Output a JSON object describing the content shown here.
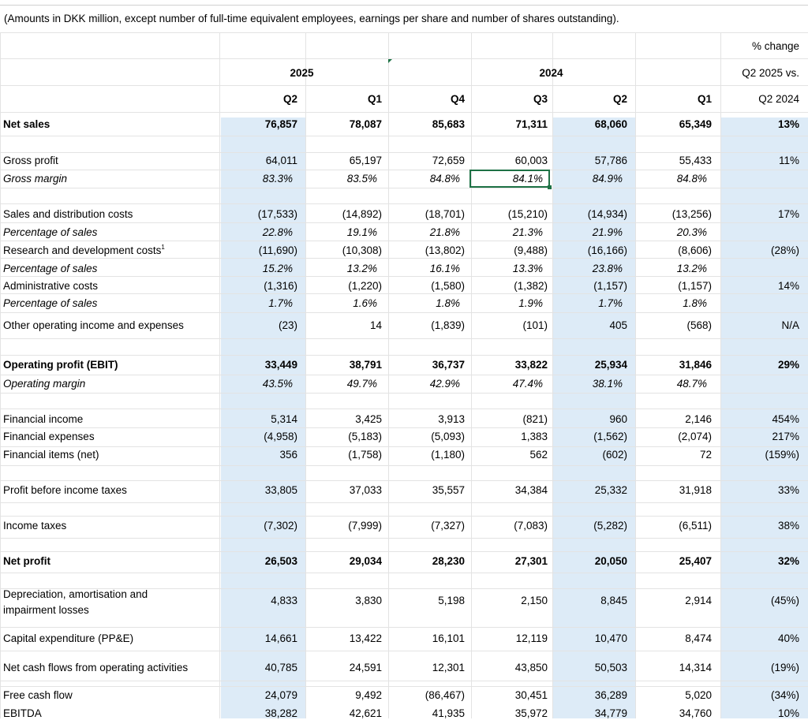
{
  "note": "(Amounts in DKK million, except number of full-time equivalent employees, earnings per share and number of shares outstanding).",
  "headers": {
    "pct_change": "% change",
    "year_2025": "2025",
    "year_2024": "2024",
    "pct_line2": "Q2 2025 vs.",
    "pct_line3": "Q2 2024",
    "quarters": [
      "Q2",
      "Q1",
      "Q4",
      "Q3",
      "Q2",
      "Q1"
    ]
  },
  "rows": [
    {
      "label": "Net sales",
      "values": [
        "76,857",
        "78,087",
        "85,683",
        "71,311",
        "68,060",
        "65,349"
      ],
      "change": "13%"
    },
    {
      "label": "Gross profit",
      "values": [
        "64,011",
        "65,197",
        "72,659",
        "60,003",
        "57,786",
        "55,433"
      ],
      "change": "11%"
    },
    {
      "label": "Gross margin",
      "values": [
        "83.3%",
        "83.5%",
        "84.8%",
        "84.1%",
        "84.9%",
        "84.8%"
      ],
      "change": ""
    },
    {
      "label": "Sales and distribution costs",
      "values": [
        "(17,533)",
        "(14,892)",
        "(18,701)",
        "(15,210)",
        "(14,934)",
        "(13,256)"
      ],
      "change": "17%"
    },
    {
      "label": "Percentage of sales",
      "values": [
        "22.8%",
        "19.1%",
        "21.8%",
        "21.3%",
        "21.9%",
        "20.3%"
      ],
      "change": ""
    },
    {
      "label": "Research and development costs",
      "footnote": "1",
      "values": [
        "(11,690)",
        "(10,308)",
        "(13,802)",
        "(9,488)",
        "(16,166)",
        "(8,606)"
      ],
      "change": "(28%)"
    },
    {
      "label": "Percentage of sales",
      "values": [
        "15.2%",
        "13.2%",
        "16.1%",
        "13.3%",
        "23.8%",
        "13.2%"
      ],
      "change": ""
    },
    {
      "label": "Administrative costs",
      "values": [
        "(1,316)",
        "(1,220)",
        "(1,580)",
        "(1,382)",
        "(1,157)",
        "(1,157)"
      ],
      "change": "14%"
    },
    {
      "label": "Percentage of sales",
      "values": [
        "1.7%",
        "1.6%",
        "1.8%",
        "1.9%",
        "1.7%",
        "1.8%"
      ],
      "change": ""
    },
    {
      "label": "Other operating income and expenses",
      "values": [
        "(23)",
        "14",
        "(1,839)",
        "(101)",
        "405",
        "(568)"
      ],
      "change": "N/A"
    },
    {
      "label": "Operating profit (EBIT)",
      "values": [
        "33,449",
        "38,791",
        "36,737",
        "33,822",
        "25,934",
        "31,846"
      ],
      "change": "29%"
    },
    {
      "label": "Operating margin",
      "values": [
        "43.5%",
        "49.7%",
        "42.9%",
        "47.4%",
        "38.1%",
        "48.7%"
      ],
      "change": ""
    },
    {
      "label": "Financial income",
      "values": [
        "5,314",
        "3,425",
        "3,913",
        "(821)",
        "960",
        "2,146"
      ],
      "change": "454%"
    },
    {
      "label": "Financial expenses",
      "values": [
        "(4,958)",
        "(5,183)",
        "(5,093)",
        "1,383",
        "(1,562)",
        "(2,074)"
      ],
      "change": "217%"
    },
    {
      "label": "Financial items (net)",
      "values": [
        "356",
        "(1,758)",
        "(1,180)",
        "562",
        "(602)",
        "72"
      ],
      "change": "(159%)"
    },
    {
      "label": "Profit before income taxes",
      "values": [
        "33,805",
        "37,033",
        "35,557",
        "34,384",
        "25,332",
        "31,918"
      ],
      "change": "33%"
    },
    {
      "label": "Income taxes",
      "values": [
        "(7,302)",
        "(7,999)",
        "(7,327)",
        "(7,083)",
        "(5,282)",
        "(6,511)"
      ],
      "change": "38%"
    },
    {
      "label": "Net profit",
      "values": [
        "26,503",
        "29,034",
        "28,230",
        "27,301",
        "20,050",
        "25,407"
      ],
      "change": "32%"
    },
    {
      "label": "Depreciation, amortisation and",
      "label2": "impairment losses",
      "values": [
        "4,833",
        "3,830",
        "5,198",
        "2,150",
        "8,845",
        "2,914"
      ],
      "change": "(45%)"
    },
    {
      "label": "Capital expenditure (PP&E)",
      "values": [
        "14,661",
        "13,422",
        "16,101",
        "12,119",
        "10,470",
        "8,474"
      ],
      "change": "40%"
    },
    {
      "label": "Net cash flows from operating activities",
      "values": [
        "40,785",
        "24,591",
        "12,301",
        "43,850",
        "50,503",
        "14,314"
      ],
      "change": "(19%)"
    },
    {
      "label": "Free cash flow",
      "values": [
        "24,079",
        "9,492",
        "(86,467)",
        "30,451",
        "36,289",
        "5,020"
      ],
      "change": "(34%)"
    },
    {
      "label": "EBITDA",
      "values": [
        "38,282",
        "42,621",
        "41,935",
        "35,972",
        "34,779",
        "34,760"
      ],
      "change": "10%"
    }
  ]
}
